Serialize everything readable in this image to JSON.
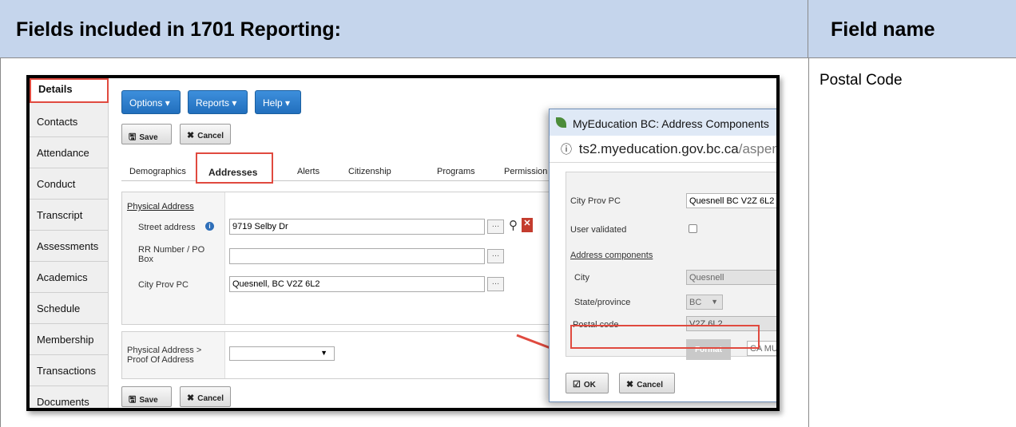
{
  "document": {
    "header_left": "Fields included in 1701 Reporting:",
    "header_right": "Field name",
    "field_name_value": "Postal Code",
    "colors": {
      "header_bg": "#c5d5ec",
      "highlight": "#e04a3f",
      "button_blue": "#226fbd"
    }
  },
  "sidenav": {
    "items": [
      {
        "label": "Details"
      },
      {
        "label": "Contacts"
      },
      {
        "label": "Attendance"
      },
      {
        "label": "Conduct"
      },
      {
        "label": "Transcript"
      },
      {
        "label": "Assessments"
      },
      {
        "label": "Academics"
      },
      {
        "label": "Schedule"
      },
      {
        "label": "Membership"
      },
      {
        "label": "Transactions"
      },
      {
        "label": "Documents"
      }
    ]
  },
  "toolbar": {
    "options_label": "Options",
    "reports_label": "Reports",
    "help_label": "Help",
    "save_label": "Save",
    "cancel_label": "Cancel"
  },
  "tabs": {
    "items": [
      {
        "label": "Demographics"
      },
      {
        "label": "Addresses"
      },
      {
        "label": "Alerts"
      },
      {
        "label": "Citizenship"
      },
      {
        "label": "Programs"
      },
      {
        "label": "Permission"
      }
    ]
  },
  "physical_address": {
    "section_label": "Physical Address",
    "street_label": "Street address",
    "street_value": "9719 Selby Dr",
    "rr_label": "RR Number / PO Box",
    "rr_value": "",
    "city_label": "City Prov PC",
    "city_value": "Quesnell, BC V2Z 6L2",
    "proof_label": "Physical Address > Proof Of Address",
    "proof_value": ""
  },
  "popup": {
    "title": "MyEducation BC: Address Components",
    "url_host": "ts2.myeducation.gov.bc.ca",
    "url_path": "/aspen",
    "city_prov_pc_label": "City Prov PC",
    "city_prov_pc_value": "Quesnell BC  V2Z 6L2",
    "user_validated_label": "User validated",
    "address_components_label": "Address components",
    "city_label": "City",
    "city_value": "Quesnell",
    "state_label": "State/province",
    "state_value": "BC",
    "postal_label": "Postal code",
    "postal_value": "V2Z 6L2",
    "format_label": "Format",
    "format_value": "CA MU",
    "ok_label": "OK",
    "cancel_label": "Cancel"
  }
}
